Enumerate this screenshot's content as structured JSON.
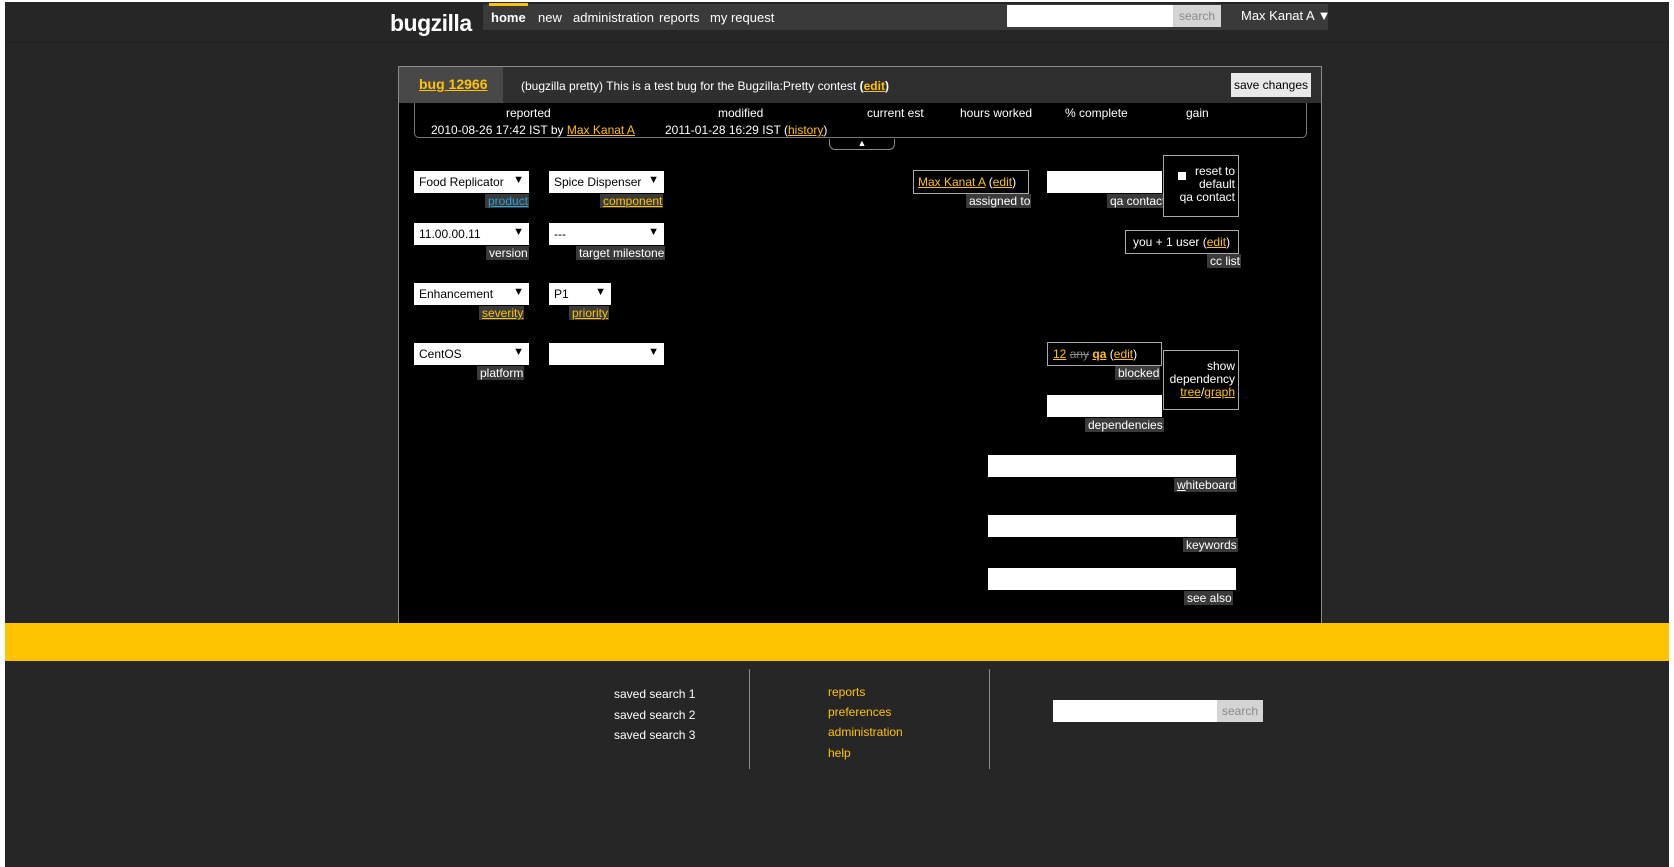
{
  "app": {
    "logo": "bugzilla"
  },
  "nav": {
    "items": [
      {
        "label": "home"
      },
      {
        "label": "new"
      },
      {
        "label": "administration"
      },
      {
        "label": "reports"
      },
      {
        "label": "my request"
      }
    ],
    "search_button": "search",
    "user": "Max Kanat A ▼"
  },
  "bug": {
    "id_label": "bug 12966",
    "summary": "(bugzilla pretty) This is a test bug for the Bugzilla:Pretty contest",
    "edit_open": "(",
    "edit_link": "edit",
    "edit_close": ")",
    "save_label": "save changes"
  },
  "stats": {
    "headers": {
      "reported": "reported",
      "modified": "modified",
      "current_est": "current est",
      "hours_worked": "hours worked",
      "percent_complete": "% complete",
      "gain": "gain"
    },
    "reported_value": "2010-08-26 17:42 IST by",
    "reported_by": "Max Kanat A",
    "modified_value": "2011-01-28 16:29 IST (",
    "history_link": "history",
    "modified_close": ")",
    "collapse_arrow": "▲"
  },
  "fields": {
    "product": {
      "value": "Food Replicator",
      "label": "product"
    },
    "component": {
      "value": "Spice Dispenser",
      "label": "component"
    },
    "version": {
      "value": "11.00.00.11",
      "label": "version"
    },
    "target_milestone": {
      "value": "---",
      "label": "target milestone"
    },
    "severity": {
      "value": "Enhancement",
      "label": "severity"
    },
    "priority": {
      "value": "P1",
      "label": "priority"
    },
    "platform": {
      "value": "CentOS",
      "label": "platform"
    },
    "os": {
      "value": ""
    },
    "assigned_to": {
      "name": "Max Kanat A",
      "open": " (",
      "edit": "edit",
      "close": ")",
      "label": "assigned to"
    },
    "qa_contact": {
      "label": "qa contact"
    },
    "reset_qa": {
      "line1": "reset to",
      "line2": "default",
      "line3": "qa contact"
    },
    "cc": {
      "value": "you + 1 user (",
      "edit": "edit",
      "close": ")",
      "label": "cc list"
    },
    "blocked": {
      "link1": "12",
      "link2": "any",
      "link3": "qa",
      "open": " (",
      "edit": "edit",
      "close": ")",
      "label": "blocked"
    },
    "dependency": {
      "line1": "show",
      "line2": "dependency",
      "tree": "tree",
      "slash": "/",
      "graph": "graph"
    },
    "dependencies": {
      "label": "dependencies"
    },
    "whiteboard": {
      "label_first": "w",
      "label_rest": "hiteboard"
    },
    "keywords": {
      "label": "keywords"
    },
    "see_also": {
      "label": "see also"
    }
  },
  "footer": {
    "saved": [
      "saved search 1",
      "saved search 2",
      "saved search 3"
    ],
    "links": [
      "reports",
      "preferences",
      "administration",
      "help"
    ],
    "search_button": "search"
  },
  "colors": {
    "accent": "#ffc200",
    "background": "#262626",
    "panel": "#000000",
    "product_link": "#2a9fd6"
  },
  "icons": {
    "dropdown": "chevron-down-icon",
    "collapse": "triangle-up-icon",
    "checkbox": "checkbox-icon"
  }
}
